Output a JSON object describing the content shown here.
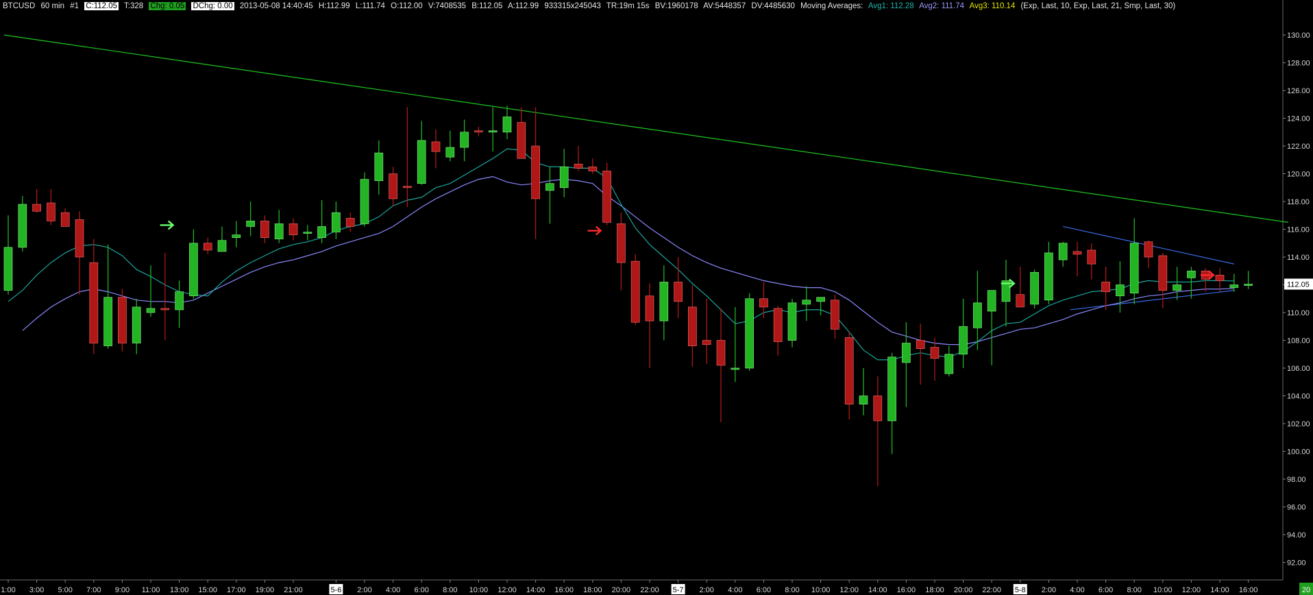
{
  "header": {
    "symbol": "BTCUSD",
    "interval": "60 min",
    "chart_id": "#1",
    "close": "C:112.05",
    "ticks": "T:328",
    "chg": "Chg: 0.05",
    "dchg": "DChg: 0.00",
    "datetime": "2013-05-08 14:40:45",
    "high": "H:112.99",
    "low": "L:111.74",
    "open": "O:112.00",
    "volume": "V:7408535",
    "bid": "B:112.05",
    "ask": "A:112.99",
    "bidask_size": "933315x245043",
    "time_remaining": "TR:19m 15s",
    "bv": "BV:1960178",
    "av": "AV:5448357",
    "dv": "DV:4485630",
    "ma_label": "Moving Averages:",
    "avg1": "Avg1: 112.28",
    "avg2": "Avg2: 111.74",
    "avg3": "Avg3: 110.14",
    "ma_params": "(Exp, Last, 10, Exp, Last, 21, Smp, Last, 30)"
  },
  "colors": {
    "background": "#000000",
    "up_candle": "#22b422",
    "down_candle": "#b01818",
    "avg1": "#1aa7a0",
    "avg2": "#8a8aff",
    "trendline_green": "#1ec81e",
    "trendline_blue": "#3a6ee8",
    "axis_text": "#d8d8d8",
    "last_price_bg": "#ffffff",
    "avg3_label": "#e6e600",
    "corner_badge": "#1f9e1f"
  },
  "price_axis": {
    "ticks": [
      "130.00",
      "128.00",
      "126.00",
      "124.00",
      "122.00",
      "120.00",
      "118.00",
      "116.00",
      "114.00",
      "112.00",
      "110.00",
      "108.00",
      "106.00",
      "104.00",
      "102.00",
      "100.00",
      "98.00",
      "96.00",
      "94.00",
      "92.00"
    ],
    "last_price_label": "112.05"
  },
  "time_axis": {
    "labels": [
      {
        "i": 0,
        "text": "1:00"
      },
      {
        "i": 2,
        "text": "3:00"
      },
      {
        "i": 4,
        "text": "5:00"
      },
      {
        "i": 6,
        "text": "7:00"
      },
      {
        "i": 8,
        "text": "9:00"
      },
      {
        "i": 10,
        "text": "11:00"
      },
      {
        "i": 12,
        "text": "13:00"
      },
      {
        "i": 14,
        "text": "15:00"
      },
      {
        "i": 16,
        "text": "17:00"
      },
      {
        "i": 18,
        "text": "19:00"
      },
      {
        "i": 20,
        "text": "21:00"
      },
      {
        "i": 23,
        "text": "5-6",
        "boxed": true
      },
      {
        "i": 25,
        "text": "2:00"
      },
      {
        "i": 27,
        "text": "4:00"
      },
      {
        "i": 29,
        "text": "6:00"
      },
      {
        "i": 31,
        "text": "8:00"
      },
      {
        "i": 33,
        "text": "10:00"
      },
      {
        "i": 35,
        "text": "12:00"
      },
      {
        "i": 37,
        "text": "14:00"
      },
      {
        "i": 39,
        "text": "16:00"
      },
      {
        "i": 41,
        "text": "18:00"
      },
      {
        "i": 43,
        "text": "20:00"
      },
      {
        "i": 45,
        "text": "22:00"
      },
      {
        "i": 47,
        "text": "5-7",
        "boxed": true
      },
      {
        "i": 49,
        "text": "2:00"
      },
      {
        "i": 51,
        "text": "4:00"
      },
      {
        "i": 53,
        "text": "6:00"
      },
      {
        "i": 55,
        "text": "8:00"
      },
      {
        "i": 57,
        "text": "10:00"
      },
      {
        "i": 59,
        "text": "12:00"
      },
      {
        "i": 61,
        "text": "14:00"
      },
      {
        "i": 63,
        "text": "16:00"
      },
      {
        "i": 65,
        "text": "18:00"
      },
      {
        "i": 67,
        "text": "20:00"
      },
      {
        "i": 69,
        "text": "22:00"
      },
      {
        "i": 71,
        "text": "5-8",
        "boxed": true
      },
      {
        "i": 73,
        "text": "2:00"
      },
      {
        "i": 75,
        "text": "4:00"
      },
      {
        "i": 77,
        "text": "6:00"
      },
      {
        "i": 79,
        "text": "8:00"
      },
      {
        "i": 81,
        "text": "10:00"
      },
      {
        "i": 83,
        "text": "12:00"
      },
      {
        "i": 85,
        "text": "14:00"
      },
      {
        "i": 87,
        "text": "16:00"
      }
    ],
    "corner_badge": "20"
  },
  "chart_data": {
    "type": "candlestick",
    "symbol": "BTCUSD",
    "interval": "60 min",
    "ylim": [
      91,
      131
    ],
    "y_ticks_step": 2,
    "candles": [
      {
        "o": 111.6,
        "h": 117.0,
        "l": 111.3,
        "c": 114.7
      },
      {
        "o": 114.7,
        "h": 118.4,
        "l": 114.4,
        "c": 117.8
      },
      {
        "o": 117.8,
        "h": 118.9,
        "l": 117.2,
        "c": 117.3
      },
      {
        "o": 117.9,
        "h": 118.9,
        "l": 116.3,
        "c": 116.6
      },
      {
        "o": 117.2,
        "h": 117.5,
        "l": 116.2,
        "c": 116.2
      },
      {
        "o": 116.7,
        "h": 117.3,
        "l": 111.3,
        "c": 114.0
      },
      {
        "o": 113.6,
        "h": 115.3,
        "l": 107.0,
        "c": 107.8
      },
      {
        "o": 107.6,
        "h": 114.9,
        "l": 107.4,
        "c": 111.1
      },
      {
        "o": 111.1,
        "h": 111.7,
        "l": 107.2,
        "c": 107.8
      },
      {
        "o": 107.8,
        "h": 111.0,
        "l": 107.0,
        "c": 110.4
      },
      {
        "o": 110.0,
        "h": 113.4,
        "l": 109.7,
        "c": 110.3
      },
      {
        "o": 110.3,
        "h": 114.3,
        "l": 108.0,
        "c": 110.2
      },
      {
        "o": 110.2,
        "h": 112.3,
        "l": 108.9,
        "c": 111.5
      },
      {
        "o": 111.2,
        "h": 116.0,
        "l": 111.0,
        "c": 115.0
      },
      {
        "o": 115.0,
        "h": 115.4,
        "l": 114.2,
        "c": 114.5
      },
      {
        "o": 114.4,
        "h": 116.2,
        "l": 114.4,
        "c": 115.2
      },
      {
        "o": 115.4,
        "h": 116.6,
        "l": 114.7,
        "c": 115.6
      },
      {
        "o": 116.2,
        "h": 118.0,
        "l": 115.5,
        "c": 116.6
      },
      {
        "o": 116.6,
        "h": 117.0,
        "l": 115.0,
        "c": 115.4
      },
      {
        "o": 115.3,
        "h": 117.4,
        "l": 115.0,
        "c": 116.4
      },
      {
        "o": 116.4,
        "h": 116.8,
        "l": 115.2,
        "c": 115.6
      },
      {
        "o": 115.8,
        "h": 116.3,
        "l": 115.2,
        "c": 115.8
      },
      {
        "o": 115.4,
        "h": 118.1,
        "l": 115.0,
        "c": 116.2
      },
      {
        "o": 115.8,
        "h": 118.0,
        "l": 115.3,
        "c": 117.2
      },
      {
        "o": 116.8,
        "h": 117.2,
        "l": 115.8,
        "c": 116.2
      },
      {
        "o": 116.4,
        "h": 120.1,
        "l": 116.2,
        "c": 119.6
      },
      {
        "o": 119.5,
        "h": 122.4,
        "l": 118.5,
        "c": 121.5
      },
      {
        "o": 120.0,
        "h": 120.5,
        "l": 117.7,
        "c": 118.2
      },
      {
        "o": 119.1,
        "h": 124.8,
        "l": 117.6,
        "c": 119.0
      },
      {
        "o": 119.3,
        "h": 123.8,
        "l": 119.2,
        "c": 122.4
      },
      {
        "o": 122.3,
        "h": 123.2,
        "l": 120.4,
        "c": 121.6
      },
      {
        "o": 121.2,
        "h": 123.1,
        "l": 120.9,
        "c": 121.9
      },
      {
        "o": 121.9,
        "h": 123.9,
        "l": 120.9,
        "c": 123.0
      },
      {
        "o": 123.1,
        "h": 123.4,
        "l": 122.7,
        "c": 123.0
      },
      {
        "o": 123.0,
        "h": 124.8,
        "l": 121.6,
        "c": 123.1
      },
      {
        "o": 123.0,
        "h": 124.9,
        "l": 122.5,
        "c": 124.1
      },
      {
        "o": 123.7,
        "h": 124.8,
        "l": 121.4,
        "c": 121.1
      },
      {
        "o": 122.0,
        "h": 124.8,
        "l": 115.3,
        "c": 118.2
      },
      {
        "o": 118.8,
        "h": 120.5,
        "l": 116.4,
        "c": 119.3
      },
      {
        "o": 119.0,
        "h": 121.8,
        "l": 118.3,
        "c": 120.5
      },
      {
        "o": 120.7,
        "h": 122.0,
        "l": 120.2,
        "c": 120.4
      },
      {
        "o": 120.5,
        "h": 121.1,
        "l": 120.0,
        "c": 120.2
      },
      {
        "o": 120.2,
        "h": 120.8,
        "l": 116.3,
        "c": 116.5
      },
      {
        "o": 116.4,
        "h": 117.2,
        "l": 111.6,
        "c": 113.6
      },
      {
        "o": 113.7,
        "h": 114.2,
        "l": 109.1,
        "c": 109.3
      },
      {
        "o": 111.2,
        "h": 112.1,
        "l": 106.0,
        "c": 109.4
      },
      {
        "o": 109.4,
        "h": 113.4,
        "l": 108.0,
        "c": 112.2
      },
      {
        "o": 112.2,
        "h": 114.0,
        "l": 109.6,
        "c": 110.8
      },
      {
        "o": 110.4,
        "h": 112.0,
        "l": 106.1,
        "c": 107.6
      },
      {
        "o": 108.0,
        "h": 111.0,
        "l": 106.3,
        "c": 107.7
      },
      {
        "o": 108.0,
        "h": 110.3,
        "l": 102.1,
        "c": 106.2
      },
      {
        "o": 106.0,
        "h": 110.4,
        "l": 105.0,
        "c": 106.0
      },
      {
        "o": 106.0,
        "h": 111.4,
        "l": 105.8,
        "c": 111.0
      },
      {
        "o": 111.0,
        "h": 112.2,
        "l": 109.6,
        "c": 110.4
      },
      {
        "o": 110.3,
        "h": 110.5,
        "l": 106.9,
        "c": 107.9
      },
      {
        "o": 108.0,
        "h": 111.0,
        "l": 107.5,
        "c": 110.7
      },
      {
        "o": 110.6,
        "h": 111.9,
        "l": 109.4,
        "c": 110.9
      },
      {
        "o": 110.8,
        "h": 111.1,
        "l": 109.8,
        "c": 111.1
      },
      {
        "o": 110.9,
        "h": 111.3,
        "l": 108.1,
        "c": 108.8
      },
      {
        "o": 108.2,
        "h": 108.6,
        "l": 102.3,
        "c": 103.4
      },
      {
        "o": 103.4,
        "h": 106.0,
        "l": 102.6,
        "c": 104.0
      },
      {
        "o": 104.0,
        "h": 105.4,
        "l": 97.5,
        "c": 102.2
      },
      {
        "o": 102.2,
        "h": 107.1,
        "l": 99.8,
        "c": 106.8
      },
      {
        "o": 106.4,
        "h": 109.3,
        "l": 103.2,
        "c": 107.8
      },
      {
        "o": 108.0,
        "h": 109.2,
        "l": 104.8,
        "c": 107.4
      },
      {
        "o": 107.5,
        "h": 108.2,
        "l": 105.1,
        "c": 106.7
      },
      {
        "o": 105.6,
        "h": 107.6,
        "l": 105.4,
        "c": 107.0
      },
      {
        "o": 107.0,
        "h": 111.0,
        "l": 106.0,
        "c": 109.0
      },
      {
        "o": 108.9,
        "h": 113.0,
        "l": 107.3,
        "c": 110.7
      },
      {
        "o": 110.1,
        "h": 111.4,
        "l": 106.2,
        "c": 111.6
      },
      {
        "o": 110.8,
        "h": 113.8,
        "l": 109.0,
        "c": 112.3
      },
      {
        "o": 111.3,
        "h": 113.3,
        "l": 110.9,
        "c": 110.4
      },
      {
        "o": 110.6,
        "h": 113.1,
        "l": 110.3,
        "c": 112.9
      },
      {
        "o": 110.9,
        "h": 115.1,
        "l": 110.6,
        "c": 114.3
      },
      {
        "o": 113.8,
        "h": 115.1,
        "l": 113.3,
        "c": 115.0
      },
      {
        "o": 114.4,
        "h": 115.1,
        "l": 112.6,
        "c": 114.2
      },
      {
        "o": 114.5,
        "h": 115.0,
        "l": 112.4,
        "c": 113.5
      },
      {
        "o": 112.2,
        "h": 113.3,
        "l": 110.2,
        "c": 111.5
      },
      {
        "o": 111.2,
        "h": 113.7,
        "l": 110.0,
        "c": 112.0
      },
      {
        "o": 111.4,
        "h": 116.8,
        "l": 110.6,
        "c": 115.0
      },
      {
        "o": 115.1,
        "h": 115.2,
        "l": 113.2,
        "c": 114.0
      },
      {
        "o": 114.1,
        "h": 114.3,
        "l": 110.3,
        "c": 111.6
      },
      {
        "o": 111.6,
        "h": 113.3,
        "l": 110.9,
        "c": 112.0
      },
      {
        "o": 112.5,
        "h": 113.3,
        "l": 111.0,
        "c": 113.0
      },
      {
        "o": 113.0,
        "h": 113.2,
        "l": 111.5,
        "c": 112.4
      },
      {
        "o": 112.7,
        "h": 113.2,
        "l": 111.5,
        "c": 112.3
      },
      {
        "o": 111.8,
        "h": 112.8,
        "l": 111.5,
        "c": 112.0
      },
      {
        "o": 112.0,
        "h": 113.0,
        "l": 111.7,
        "c": 112.05
      }
    ],
    "avg1_ema10": [
      110.8,
      111.6,
      112.7,
      113.6,
      114.3,
      114.8,
      114.9,
      114.7,
      114.1,
      113.1,
      112.6,
      112.0,
      111.5,
      111.3,
      111.2,
      112.2,
      113.0,
      113.6,
      114.1,
      114.6,
      114.9,
      115.1,
      115.4,
      115.9,
      116.2,
      116.4,
      116.9,
      117.7,
      118.1,
      118.3,
      119.0,
      119.3,
      119.9,
      120.5,
      121.1,
      121.8,
      121.7,
      120.8,
      120.5,
      120.5,
      120.4,
      120.4,
      119.7,
      117.8,
      116.1,
      114.9,
      114.0,
      113.1,
      112.1,
      111.2,
      110.2,
      109.2,
      109.4,
      110.0,
      110.2,
      110.0,
      110.2,
      110.2,
      109.8,
      108.6,
      107.3,
      106.6,
      106.6,
      106.9,
      107.1,
      106.9,
      106.8,
      107.2,
      107.9,
      108.7,
      109.2,
      109.3,
      109.9,
      110.5,
      110.9,
      111.2,
      111.5,
      111.6,
      111.7,
      112.1,
      112.3,
      112.2,
      112.2,
      112.2,
      112.3,
      112.3,
      112.28
    ],
    "avg2_ema21": [
      108.7,
      109.6,
      110.4,
      111.0,
      111.5,
      111.7,
      111.5,
      111.2,
      110.9,
      110.8,
      110.8,
      110.7,
      110.9,
      111.4,
      111.9,
      112.4,
      112.9,
      113.3,
      113.6,
      113.8,
      114.1,
      114.4,
      114.8,
      115.1,
      115.4,
      115.7,
      116.2,
      116.9,
      117.6,
      118.2,
      118.7,
      119.2,
      119.6,
      119.8,
      119.4,
      119.2,
      119.3,
      119.5,
      119.6,
      119.5,
      119.3,
      118.4,
      117.7,
      116.9,
      116.1,
      115.4,
      114.7,
      114.1,
      113.6,
      113.2,
      112.9,
      112.6,
      112.3,
      112.1,
      111.9,
      111.8,
      111.8,
      111.5,
      110.9,
      110.1,
      109.3,
      108.6,
      108.3,
      108.0,
      107.8,
      107.7,
      107.7,
      107.9,
      108.2,
      108.5,
      108.8,
      108.9,
      109.2,
      109.5,
      109.9,
      110.2,
      110.5,
      110.7,
      111.0,
      111.2,
      111.3,
      111.5,
      111.6,
      111.7,
      111.7,
      111.74
    ],
    "avg2_start_index": 1,
    "trendlines": [
      {
        "name": "resistance",
        "color": "green",
        "from": {
          "i": -0.3,
          "price": 130.0
        },
        "to": {
          "i": 89.8,
          "price": 116.5
        }
      },
      {
        "name": "triangle-top",
        "color": "blue",
        "from": {
          "i": 74.0,
          "price": 116.2
        },
        "to": {
          "i": 86.0,
          "price": 113.5
        }
      },
      {
        "name": "triangle-bottom",
        "color": "blue",
        "from": {
          "i": 74.5,
          "price": 110.2
        },
        "to": {
          "i": 86.0,
          "price": 111.6
        }
      }
    ],
    "signals": [
      {
        "i": 12,
        "type": "buy",
        "price": 116.3
      },
      {
        "i": 42,
        "type": "sell",
        "price": 115.9
      },
      {
        "i": 71,
        "type": "buy",
        "price": 112.1
      },
      {
        "i": 85,
        "type": "sell",
        "price": 112.7
      }
    ],
    "last_price": 112.05
  }
}
